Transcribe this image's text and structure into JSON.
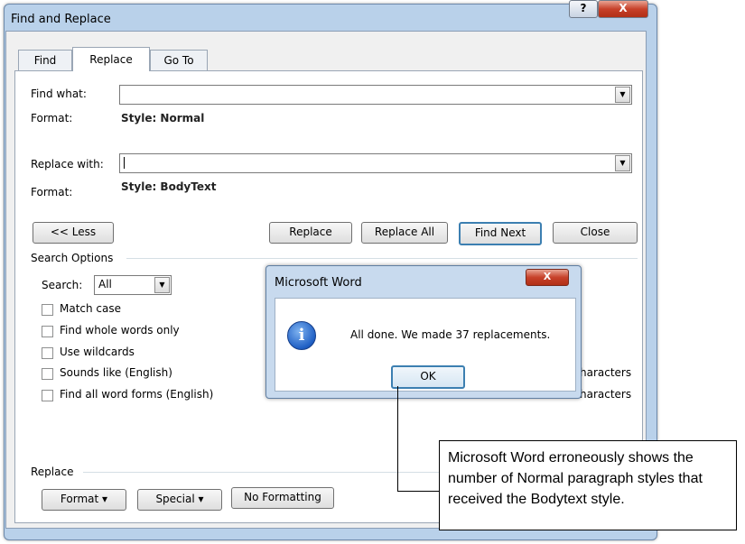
{
  "dialog": {
    "title": "Find and Replace",
    "help_glyph": "?",
    "close_glyph": "X",
    "tabs": [
      {
        "label": "Find",
        "active": false
      },
      {
        "label": "Replace",
        "active": true
      },
      {
        "label": "Go To",
        "active": false
      }
    ],
    "find_what": {
      "label": "Find what:",
      "value": ""
    },
    "find_format": {
      "label": "Format:",
      "value": "Style: Normal"
    },
    "replace_with": {
      "label": "Replace with:",
      "value": ""
    },
    "replace_format": {
      "label": "Format:",
      "value": "Style: BodyText"
    },
    "buttons": {
      "less": "<< Less",
      "replace": "Replace",
      "replace_all": "Replace All",
      "find_next": "Find Next",
      "close": "Close"
    },
    "search_options": {
      "header": "Search Options",
      "search_label": "Search:",
      "search_value": "All",
      "checkboxes": [
        {
          "label": "Match case",
          "checked": false
        },
        {
          "label": "Find whole words only",
          "checked": false
        },
        {
          "label": "Use wildcards",
          "checked": false
        },
        {
          "label": "Sounds like (English)",
          "checked": false
        },
        {
          "label": "Find all word forms (English)",
          "checked": false
        }
      ],
      "right_partial_1": "haracters",
      "right_partial_2": "haracters"
    },
    "replace_section": {
      "header": "Replace",
      "format_button": "Format",
      "special_button": "Special",
      "no_formatting_button": "No Formatting"
    }
  },
  "message_box": {
    "title": "Microsoft Word",
    "close_glyph": "X",
    "icon": "info-icon",
    "text": "All done. We made 37 replacements.",
    "ok": "OK"
  },
  "callout": {
    "text": "Microsoft Word erroneously shows the number of Normal paragraph styles that received the Bodytext style."
  }
}
